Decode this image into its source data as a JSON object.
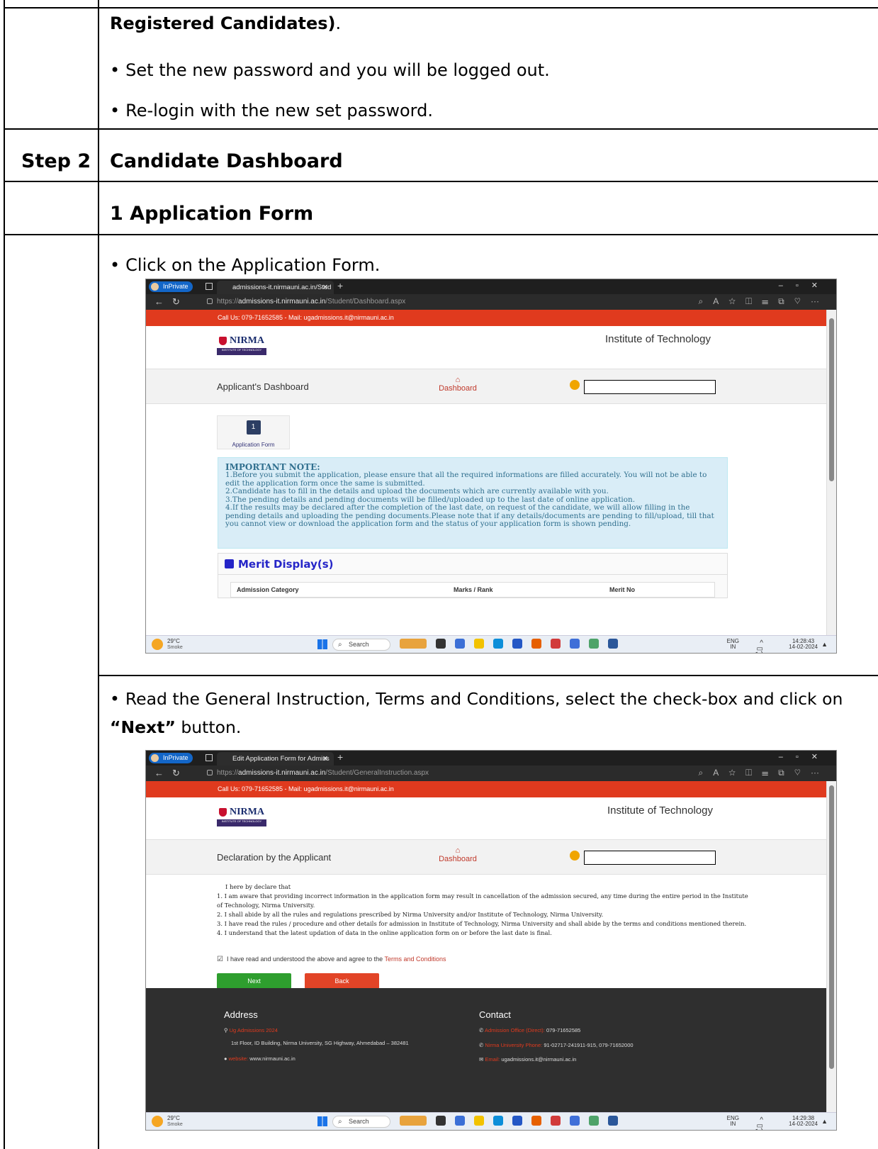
{
  "doc": {
    "top_bold": "Registered Candidates)",
    "top_bold_tail": ".",
    "bullets_top": [
      "Set the new password and you will be logged out.",
      "Re-login with the new set password."
    ],
    "step_label": "Step 2",
    "step_title": "Candidate Dashboard",
    "section_title": "1 Application Form",
    "bullet_click": "Click on the Application Form.",
    "bullet_read_1": "Read the General Instruction, Terms and Conditions, select the check-box and click on",
    "bullet_read_next": "“Next”",
    "bullet_read_2": " button."
  },
  "browser": {
    "inprivate": "InPrivate",
    "tab1_title": "admissions-it.nirmauni.ac.in/Stud",
    "tab2_title": "Edit Application Form for Admiss",
    "url1_prefix": "https://",
    "url1_host": "admissions-it.nirmauni.ac.in",
    "url1_path": "/Student/Dashboard.aspx",
    "url2_prefix": "https://",
    "url2_host": "admissions-it.nirmauni.ac.in",
    "url2_path": "/Student/GeneralInstruction.aspx"
  },
  "site": {
    "call_bar": "Call Us: 079-71652585 - Mail: ugadmissions.it@nirmauni.ac.in",
    "logo_name": "NIRMA",
    "logo_sub": "INSTITUTE OF TECHNOLOGY",
    "institute": "Institute of Technology",
    "dashboard_link": "Dashboard"
  },
  "dashboard": {
    "title": "Applicant's Dashboard",
    "step_number": "1",
    "step_label": "Application Form",
    "note_title": "IMPORTANT NOTE:",
    "note_lines": [
      "1.Before you submit the application, please ensure that all the required informations are filled accurately. You will not be able to edit the application form once the same is submitted.",
      "2.Candidate has to fill in the details and upload the documents which are currently available with you.",
      "3.The pending details and pending documents will be filled/uploaded up to the last date of online application.",
      "4.If the results may be declared after the completion of the last date, on request of the candidate, we will allow filling in the pending details and uploading the pending documents.Please note that if any details/documents are pending to fill/upload, till that you cannot view or download the application form and the status of your application form is shown pending."
    ],
    "merit_title": "Merit Display(s)",
    "merit_cols": [
      "Admission Category",
      "Marks / Rank",
      "Merit No"
    ]
  },
  "declaration": {
    "title": "Declaration by the Applicant",
    "intro": "I here by declare that",
    "items": [
      "1. I am aware that providing incorrect information in the application form may result in cancellation of the admission secured, any time during the entire period in the Institute of Technology, Nirma University.",
      "2. I shall abide by all the rules and regulations prescribed by Nirma University and/or Institute of Technology, Nirma University.",
      "3. I have read the rules / procedure and other details for admission in Institute of Technology, Nirma University and shall abide by the terms and conditions mentioned therein.",
      "4. I understand that the latest updation of data in the online application form on or before the last date is final."
    ],
    "checkbox_text": "I have read and understood the above and agree to the ",
    "checkbox_link": "Terms and Conditions",
    "next_label": "Next",
    "back_label": "Back",
    "footer_address_title": "Address",
    "footer_contact_title": "Contact",
    "addr_label": "Ug Admissions 2024",
    "addr_line": "1st Floor, ID Building, Nirma University, SG Highway, Ahmedabad – 382481",
    "website_label": "website:",
    "website": "www.nirmauni.ac.in",
    "admission_office_label": "Admission Office (Direct):",
    "admission_office_phone": "079-71652585",
    "nu_phone_label": "Nirma University Phone:",
    "nu_phone": "91-02717-241911-915, 079-71652000",
    "email_label": "Email:",
    "email": "ugadmissions.it@nirmauni.ac.in"
  },
  "taskbar": {
    "temp": "29°C",
    "condition": "Smoke",
    "search": "Search",
    "lang_1": "ENG",
    "lang_2": "IN",
    "time1": "14:28:43",
    "time2": "14:29:38",
    "date": "14-02-2024"
  },
  "colors": {
    "accent_red": "#e03a1e",
    "next_green": "#2e9e2e",
    "back_red": "#e24427",
    "note_bg": "#d9edf7"
  }
}
